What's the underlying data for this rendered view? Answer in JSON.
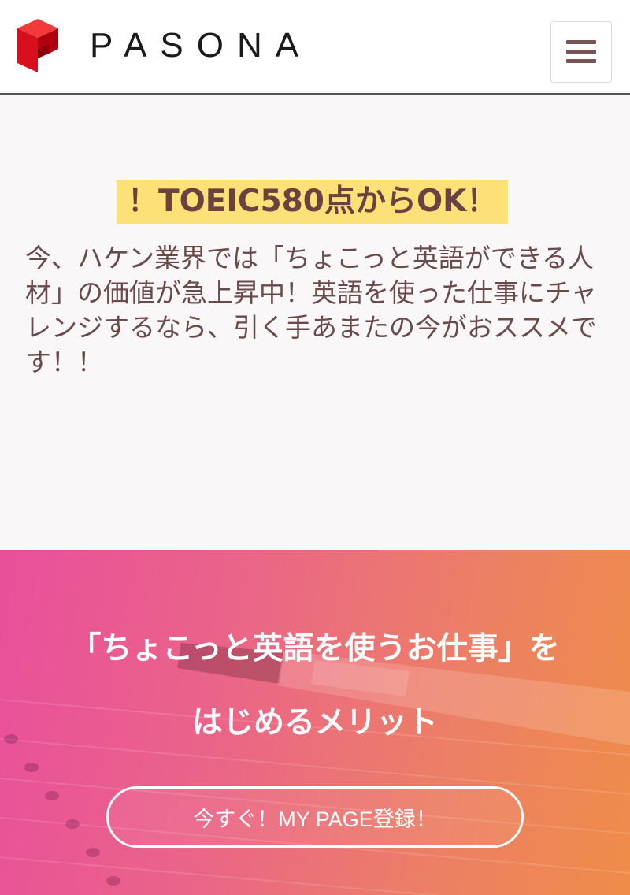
{
  "header": {
    "logo_text": "PASONA",
    "brand_color": "#e60012",
    "menu_icon": "hamburger-icon"
  },
  "intro": {
    "highlight": "！TOEIC580点からOK！",
    "body": "今、ハケン業界では「ちょこっと英語ができる人材」の価値が急上昇中！英語を使った仕事にチャレンジするなら、引く手あまたの今がおススメです！！"
  },
  "hero": {
    "title_line1": "「ちょこっと英語を使うお仕事」を",
    "title_line2": "はじめるメリット",
    "cta_label": "今すぐ！MY PAGE登録！",
    "gradient": [
      "#e94f9b",
      "#ef8c49"
    ]
  }
}
